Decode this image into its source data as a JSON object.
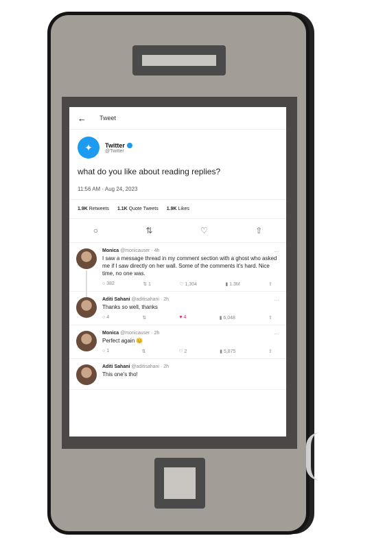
{
  "header": {
    "back_icon": "back-arrow-icon",
    "title": "Tweet"
  },
  "author": {
    "name": "Twitter",
    "handle": "@Twitter"
  },
  "tweet": {
    "text": "what do you like about reading replies?",
    "meta": "11:56 AM · Aug 24, 2023"
  },
  "stats": [
    {
      "value": "1.9K",
      "label": "Retweets"
    },
    {
      "value": "1.1K",
      "label": "Quote Tweets"
    },
    {
      "value": "1.9K",
      "label": "Likes"
    }
  ],
  "replies": [
    {
      "name": "Monica",
      "handle": "@monicauser · 4h",
      "text": "I saw a message thread in my comment section with a ghost who asked me if I saw directly on her wall. Some of the comments it's hard. Nice time, no one was.",
      "counts": {
        "reply": "382",
        "retweet": "1",
        "like": "1,304",
        "views": "1.3M"
      },
      "liked": false
    },
    {
      "name": "Aditi Sahani",
      "handle": "@aditisahani · 2h",
      "text": "Thanks so well, thanks",
      "counts": {
        "reply": "4",
        "retweet": "",
        "like": "4",
        "views": "6,048"
      },
      "liked": true
    },
    {
      "name": "Monica",
      "handle": "@monicauser · 2h",
      "text": "Perfect again 😊",
      "counts": {
        "reply": "1",
        "retweet": "",
        "like": "2",
        "views": "5,875"
      },
      "liked": false
    },
    {
      "name": "Aditi Sahani",
      "handle": "@aditisahani · 2h",
      "text": "This one's tho!",
      "counts": {
        "reply": "",
        "retweet": "",
        "like": "",
        "views": ""
      },
      "liked": false
    }
  ],
  "colors": {
    "phone_body": "#a39d98",
    "screen_frame": "#4b4747",
    "brand_blue": "#1d9bf0",
    "like_pink": "#e0245e"
  }
}
